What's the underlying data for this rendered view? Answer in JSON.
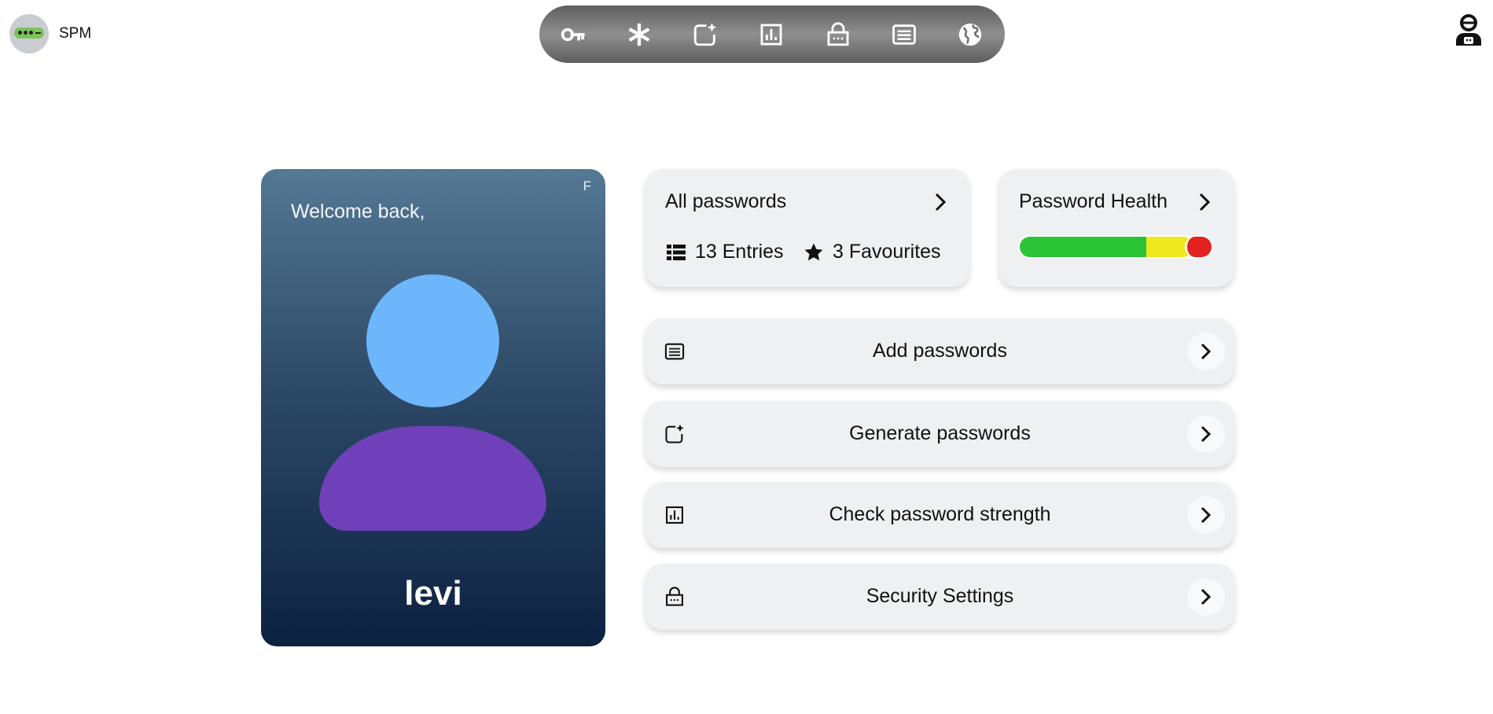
{
  "brand": {
    "name": "SPM",
    "logo_icon": "password-dots-icon"
  },
  "toolbar": {
    "items": [
      {
        "icon": "key-icon"
      },
      {
        "icon": "asterisk-icon"
      },
      {
        "icon": "generate-sparkle-icon"
      },
      {
        "icon": "bar-chart-icon"
      },
      {
        "icon": "lock-icon"
      },
      {
        "icon": "list-form-icon"
      },
      {
        "icon": "globe-icon"
      }
    ]
  },
  "account": {
    "icon": "user-account-icon"
  },
  "profile": {
    "flag": "F",
    "welcome": "Welcome back,",
    "username": "levi",
    "colors": {
      "head": "#6db6fb",
      "body": "#6f40b9"
    }
  },
  "all_passwords": {
    "title": "All passwords",
    "entries_label": "13 Entries",
    "favourites_label": "3 Favourites"
  },
  "password_health": {
    "title": "Password Health",
    "segments": [
      {
        "status": "strong",
        "fraction": 0.66,
        "color": "#2cc437"
      },
      {
        "status": "medium",
        "fraction": 0.24,
        "color": "#ede91e"
      },
      {
        "status": "weak",
        "fraction": 0.1,
        "color": "#e42121"
      }
    ]
  },
  "actions": {
    "add": {
      "label": "Add passwords",
      "icon": "list-form-icon"
    },
    "generate": {
      "label": "Generate passwords",
      "icon": "generate-sparkle-icon"
    },
    "strength": {
      "label": "Check password strength",
      "icon": "bar-chart-icon"
    },
    "security": {
      "label": "Security Settings",
      "icon": "lock-icon"
    }
  }
}
